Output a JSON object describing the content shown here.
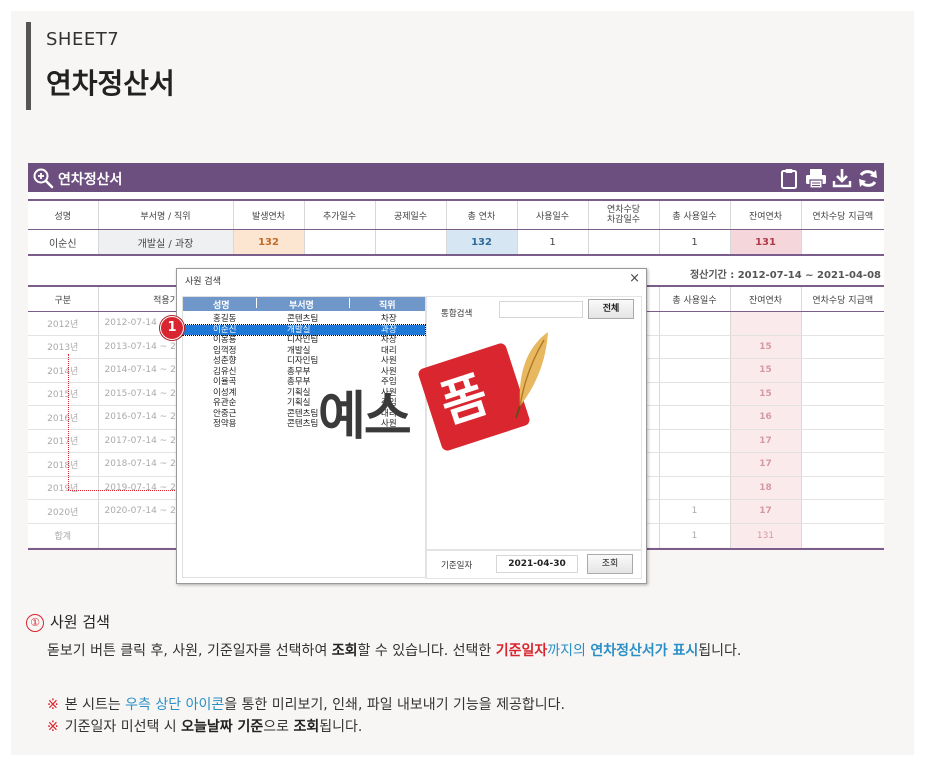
{
  "header": {
    "sheet_label": "SHEET7",
    "page_title": "연차정산서"
  },
  "app": {
    "title": "연차정산서",
    "icons": [
      "magnifier-plus-icon",
      "clipboard-icon",
      "printer-icon",
      "download-icon",
      "refresh-icon"
    ]
  },
  "summary": {
    "headers": [
      "성명",
      "부서명 / 직위",
      "발생연차",
      "추가일수",
      "공제일수",
      "총 연차",
      "사용일수",
      "연차수당\n차감일수",
      "총 사용일수",
      "잔여연차",
      "연차수당 지급액"
    ],
    "row": [
      "이순신",
      "개발실 / 과장",
      "132",
      "",
      "",
      "132",
      "1",
      "",
      "1",
      "131",
      ""
    ]
  },
  "period": {
    "label": "정산기간 : 2012-07-14 ~ 2021-04-08"
  },
  "detail": {
    "headers": [
      "구분",
      "적용기",
      "총 사용일수",
      "잔여연차",
      "연차수당 지급액"
    ],
    "rows": [
      {
        "year": "2012년",
        "range": "2012-07-14 ~",
        "used": "",
        "rem": ""
      },
      {
        "year": "2013년",
        "range": "2013-07-14 ~ 2",
        "used": "",
        "rem": "15"
      },
      {
        "year": "2014년",
        "range": "2014-07-14 ~ 2",
        "used": "",
        "rem": "15"
      },
      {
        "year": "2015년",
        "range": "2015-07-14 ~ 2",
        "used": "",
        "rem": "15"
      },
      {
        "year": "2016년",
        "range": "2016-07-14 ~ 2",
        "used": "",
        "rem": "16"
      },
      {
        "year": "2017년",
        "range": "2017-07-14 ~ 2",
        "used": "",
        "rem": "17"
      },
      {
        "year": "2018년",
        "range": "2018-07-14 ~ 2",
        "used": "",
        "rem": "17"
      },
      {
        "year": "2019년",
        "range": "2019-07-14 ~ 2",
        "used": "",
        "rem": "18"
      },
      {
        "year": "2020년",
        "range": "2020-07-14 ~ 2",
        "used": "1",
        "rem": "17"
      }
    ],
    "sum": {
      "label": "합계",
      "used": "1",
      "rem": "131"
    }
  },
  "badge": "1",
  "dialog": {
    "title": "사원 검색",
    "close": "×",
    "columns": [
      "성명",
      "부서명",
      "직위"
    ],
    "employees": [
      {
        "name": "홍길동",
        "dept": "콘텐츠팀",
        "pos": "차장"
      },
      {
        "name": "이순신",
        "dept": "개발실",
        "pos": "과장"
      },
      {
        "name": "이몽룡",
        "dept": "디자인팀",
        "pos": "차장"
      },
      {
        "name": "임꺽정",
        "dept": "개발실",
        "pos": "대리"
      },
      {
        "name": "성춘향",
        "dept": "디자인팀",
        "pos": "사원"
      },
      {
        "name": "김유신",
        "dept": "총무부",
        "pos": "사원"
      },
      {
        "name": "이율곡",
        "dept": "총무부",
        "pos": "주임"
      },
      {
        "name": "이성계",
        "dept": "기획실",
        "pos": "사원"
      },
      {
        "name": "유관순",
        "dept": "기획실",
        "pos": "주임"
      },
      {
        "name": "안중근",
        "dept": "콘텐츠팀",
        "pos": "대리"
      },
      {
        "name": "정약용",
        "dept": "콘텐츠팀",
        "pos": "사원"
      }
    ],
    "search_label": "통합검색",
    "search_value": "",
    "all_button": "전체",
    "date_label": "기준일자",
    "date_value": "2021-04-30",
    "query_button": "조회"
  },
  "watermark": {
    "text": "예스",
    "seal": "폼"
  },
  "notes": {
    "num": "①",
    "heading": "사원 검색",
    "body_1": "돋보기 버튼 클릭 후, 사원, 기준일자를 선택하여 ",
    "body_2": "조회",
    "body_3": "할 수 있습니다. 선택한 ",
    "body_4": "기준일자",
    "body_5": "까지의 ",
    "body_6": "연차정산서가 표시",
    "body_7": "됩니다.",
    "mark": "※",
    "line1_1": "본 시트는 ",
    "line1_2": "우측 상단 아이콘",
    "line1_3": "을 통한 미리보기, 인쇄, 파일 내보내기 기능을 제공합니다.",
    "line2_1": "기준일자 미선택 시 ",
    "line2_2": "오늘날짜 기준",
    "line2_3": "으로 ",
    "line2_4": "조회",
    "line2_5": "됩니다."
  },
  "colors": {
    "header_purple": "#6c4f7e",
    "accent_red": "#d8252f",
    "accent_blue": "#2a8fc7",
    "list_header": "#6f97c9",
    "selection": "#1e78d8"
  }
}
